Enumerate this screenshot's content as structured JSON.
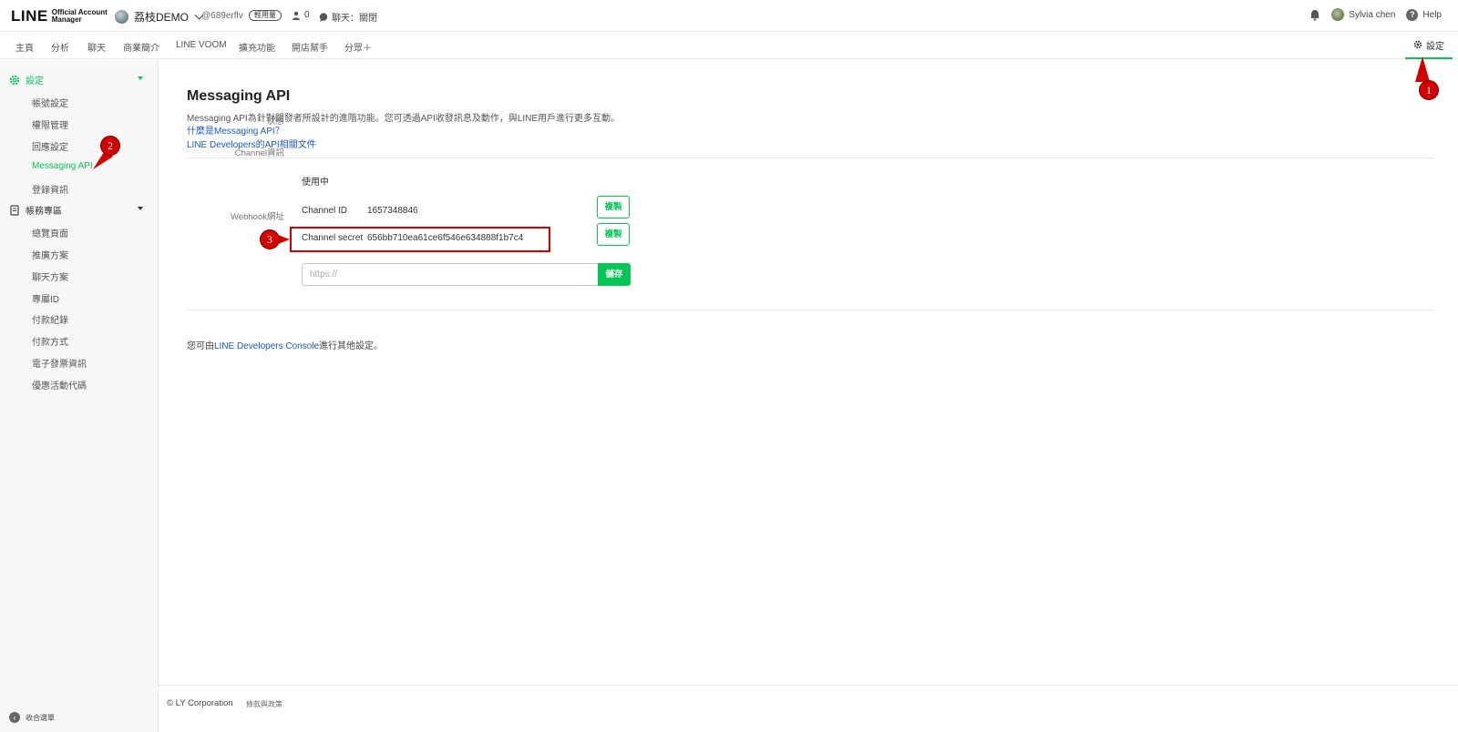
{
  "header": {
    "logo_main": "LINE",
    "logo_sub_1": "Official Account",
    "logo_sub_2": "Manager",
    "account_name": "荔枝DEMO",
    "account_id": "@689erflv",
    "plan_badge": "輕用量",
    "friends_count": "0",
    "chat_status": "聊天：關閉",
    "user_name": "Sylvia chen",
    "help_label": "Help"
  },
  "nav": {
    "items": [
      "主頁",
      "分析",
      "聊天",
      "商業簡介",
      "LINE VOOM",
      "擴充功能",
      "開店幫手",
      "分眾＋"
    ],
    "settings_label": "設定"
  },
  "sidebar": {
    "group_settings": "設定",
    "settings_items": [
      "帳號設定",
      "權限管理",
      "回應設定",
      "Messaging API",
      "登錄資訊"
    ],
    "group_billing": "帳務專區",
    "billing_items": [
      "總覽頁面",
      "推廣方案",
      "聊天方案",
      "專屬ID",
      "付款紀錄",
      "付款方式",
      "電子發票資訊",
      "優惠活動代碼"
    ],
    "collapse_label": "收合選單"
  },
  "main": {
    "title": "Messaging API",
    "description": "Messaging API為針對開發者所設計的進階功能。您可透過API收發訊息及動作，與LINE用戶進行更多互動。",
    "link_what": "什麼是Messaging API？",
    "link_docs": "LINE Developers的API相關文件",
    "status_label": "狀態",
    "status_value": "使用中",
    "channel_label": "Channel資訊",
    "channel_id_key": "Channel ID",
    "channel_id_value": "1657348846",
    "channel_secret_key": "Channel secret",
    "channel_secret_value": "656bb710ea61ce6f546e634888f1b7c4",
    "copy_label": "複製",
    "webhook_label": "Webhook網址",
    "webhook_placeholder": "https://",
    "save_label": "儲存",
    "note_prefix": "您可由",
    "note_link": "LINE Developers Console",
    "note_suffix": "進行其他設定。"
  },
  "footer": {
    "copyright": "© LY Corporation",
    "terms": "條款與政策"
  },
  "annotations": [
    "1",
    "2",
    "3"
  ]
}
